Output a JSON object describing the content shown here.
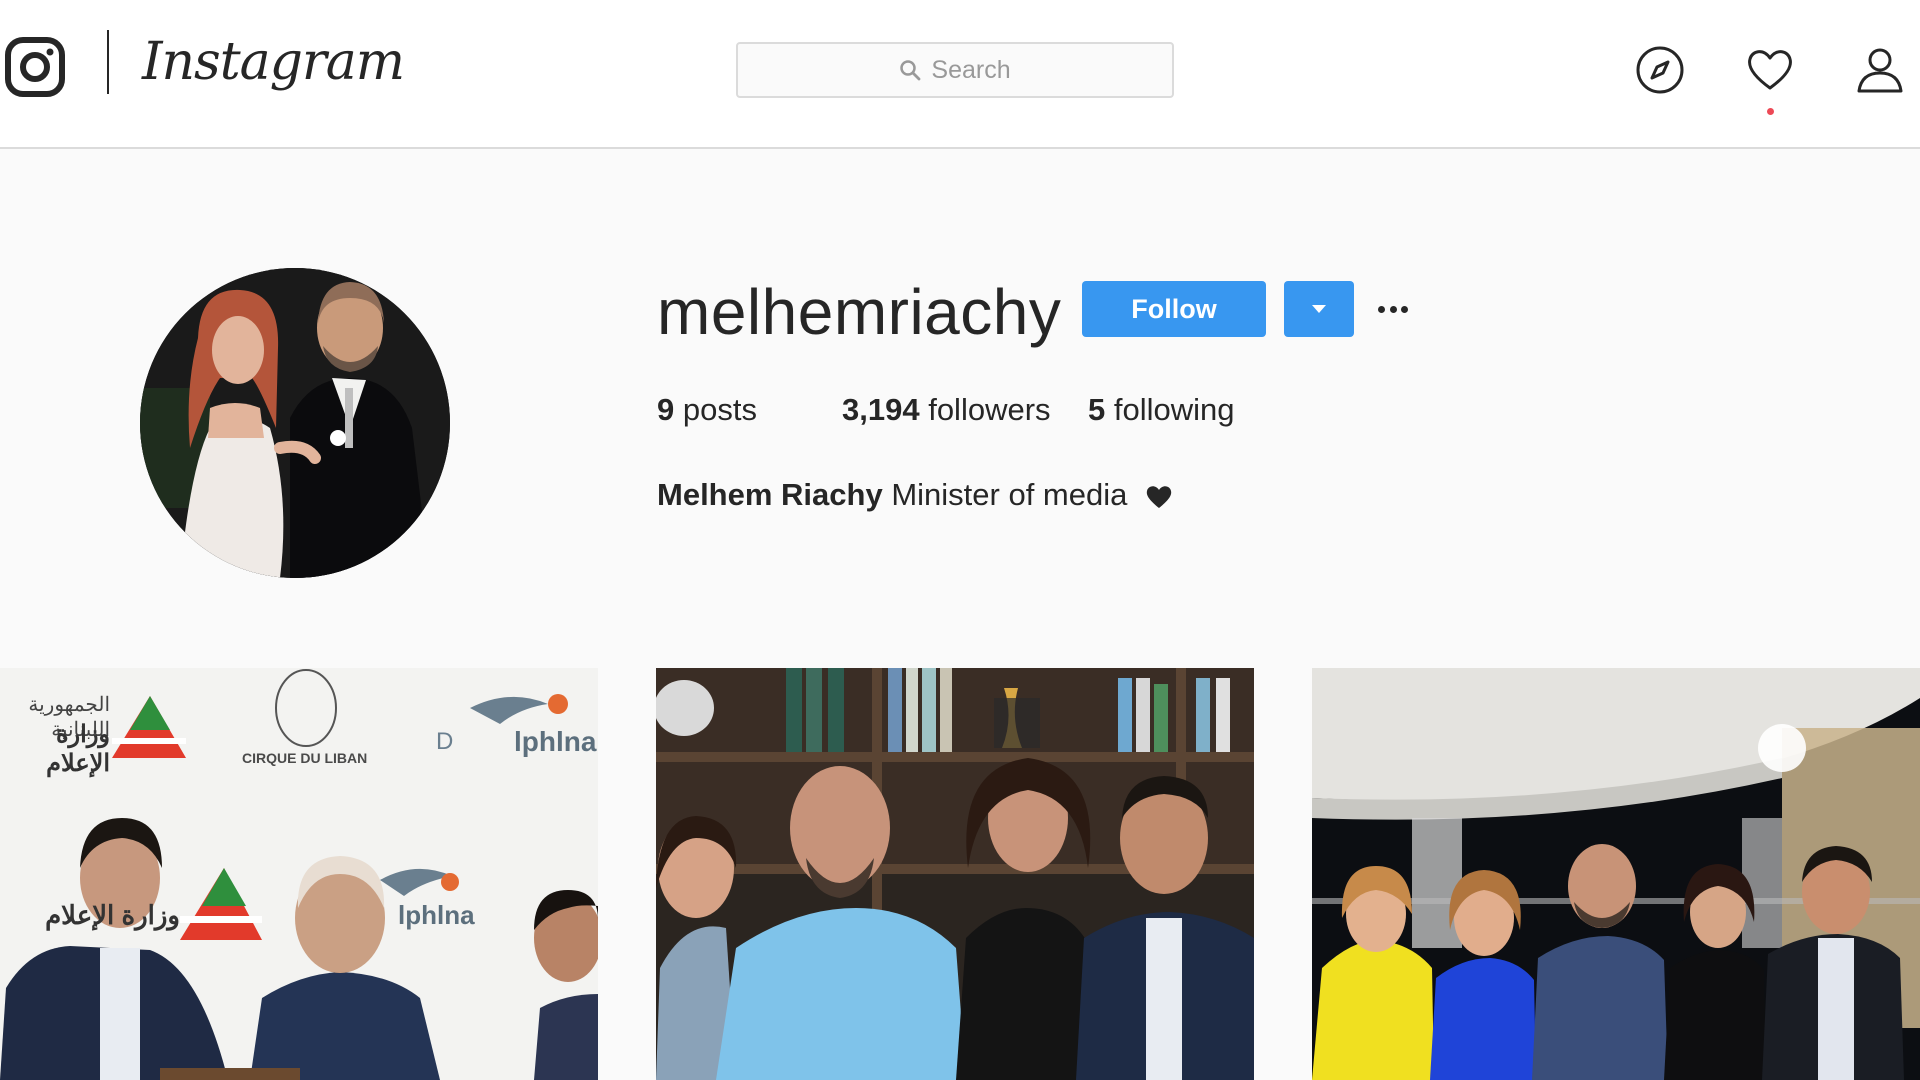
{
  "app": {
    "name": "Instagram"
  },
  "search": {
    "placeholder": "Search"
  },
  "nav": {
    "icons": [
      "compass-icon",
      "heart-icon",
      "profile-icon"
    ],
    "has_notification": true
  },
  "profile": {
    "username": "melhemriachy",
    "follow_label": "Follow",
    "stats": {
      "posts_count": "9",
      "posts_label": "posts",
      "followers_count": "3,194",
      "followers_label": "followers",
      "following_count": "5",
      "following_label": "following"
    },
    "full_name": "Melhem Riachy",
    "bio": "Minister of media",
    "bio_emoji": "black-heart"
  },
  "posts": [
    {
      "sign_texts": {
        "arabic_line1": "الجمهورية اللبنانية",
        "arabic_line2": "وزارة الإعلام",
        "cirque": "CIRQUE DU LIBAN",
        "dolphina_d": "D",
        "dolphina": "lphlna",
        "dolphina2": "lphlna",
        "arabic_line3": "وزارة الإعلام"
      }
    },
    {},
    {}
  ],
  "colors": {
    "accent": "#3897f0",
    "text": "#262626",
    "muted": "#999999",
    "border": "#dbdbdb",
    "background": "#fafafa",
    "notification": "#ed4956"
  }
}
